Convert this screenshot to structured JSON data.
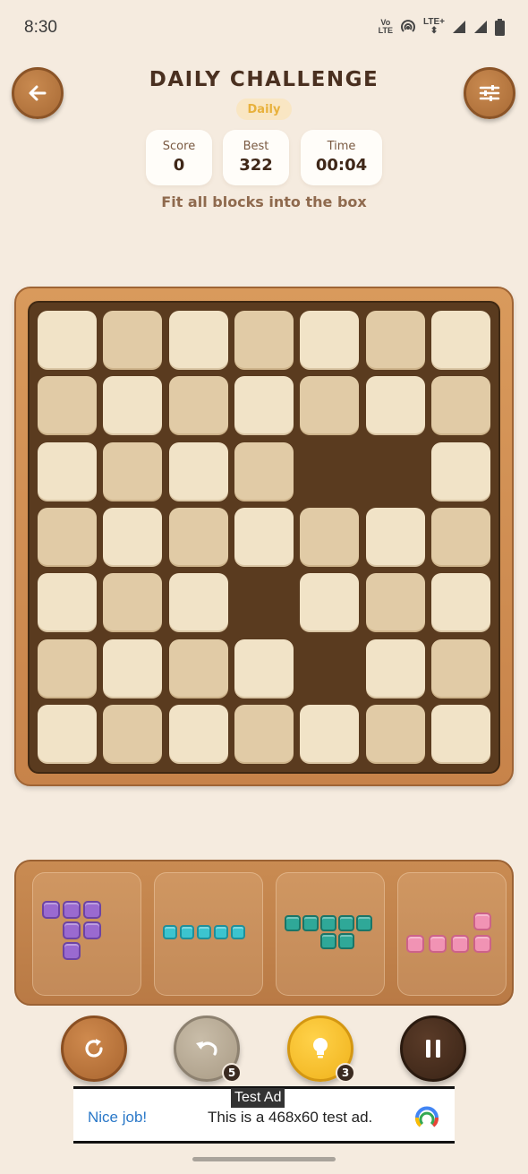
{
  "status_bar": {
    "time": "8:30",
    "volte": "Vo LTE",
    "lte": "LTE+"
  },
  "header": {
    "title": "DAILY CHALLENGE",
    "mode_badge": "Daily"
  },
  "stats": [
    {
      "label": "Score",
      "value": "0"
    },
    {
      "label": "Best",
      "value": "322"
    },
    {
      "label": "Time",
      "value": "00:04"
    }
  ],
  "instruction": "Fit all blocks into the box",
  "board": {
    "rows": 7,
    "cols": 7,
    "grid": [
      "1111111",
      "1111111",
      "1111001",
      "1111111",
      "1110111",
      "1111011",
      "1111111"
    ]
  },
  "pieces": [
    {
      "color": "purple",
      "shape": [
        "111",
        "011",
        "010"
      ]
    },
    {
      "color": "cyan",
      "shape": [
        "11111"
      ]
    },
    {
      "color": "teal",
      "shape": [
        "11111",
        "00110"
      ]
    },
    {
      "color": "pink",
      "shape": [
        "0001",
        "1111"
      ]
    }
  ],
  "actions": {
    "undo_count": "5",
    "hint_count": "3"
  },
  "ad": {
    "tag": "Test Ad",
    "headline": "Nice job!",
    "body": "This is a 468x60 test ad."
  },
  "colors": {
    "background": "#f5ebdf",
    "wood": "#c98b52",
    "board_dark": "#5a3b1f",
    "hint_yellow": "#f0b21b"
  }
}
